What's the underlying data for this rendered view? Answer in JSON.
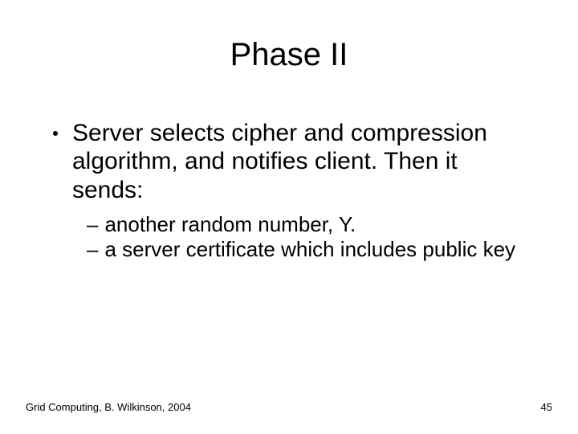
{
  "title": "Phase II",
  "bullet": {
    "text": "Server selects cipher and compression algorithm, and notifies client. Then it sends:",
    "subs": [
      "another random number, Y.",
      "a server certificate which includes public key"
    ]
  },
  "footer": {
    "left": "Grid Computing, B. Wilkinson, 2004",
    "right": "45"
  }
}
